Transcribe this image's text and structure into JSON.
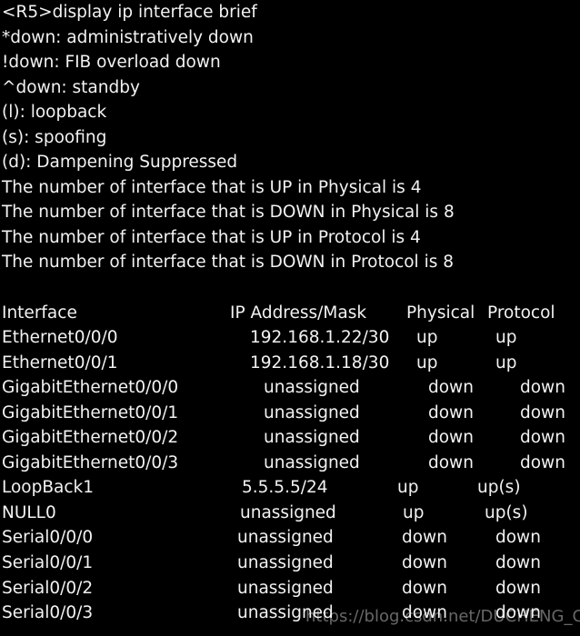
{
  "terminal": {
    "prompt_line": "<R5>display ip interface brief",
    "legend": [
      "*down: administratively down",
      "!down: FIB overload down",
      "^down: standby",
      "(l): loopback",
      "(s): spoofing",
      "(d): Dampening Suppressed"
    ],
    "summary": [
      "The number of interface that is UP in Physical is 4",
      "The number of interface that is DOWN in Physical is 8",
      "The number of interface that is UP in Protocol is 4",
      "The number of interface that is DOWN in Protocol is 8"
    ],
    "summary_counts": {
      "up_physical": 4,
      "down_physical": 8,
      "up_protocol": 4,
      "down_protocol": 8
    },
    "table": {
      "headers": {
        "interface": "Interface",
        "ip_address_mask": "IP Address/Mask",
        "physical": "Physical",
        "protocol": "Protocol"
      },
      "rows": [
        {
          "interface": "Ethernet0/0/0",
          "ip": "192.168.1.22/30",
          "physical": "up",
          "protocol": "up"
        },
        {
          "interface": "Ethernet0/0/1",
          "ip": "192.168.1.18/30",
          "physical": "up",
          "protocol": "up"
        },
        {
          "interface": "GigabitEthernet0/0/0",
          "ip": "unassigned",
          "physical": "down",
          "protocol": "down"
        },
        {
          "interface": "GigabitEthernet0/0/1",
          "ip": "unassigned",
          "physical": "down",
          "protocol": "down"
        },
        {
          "interface": "GigabitEthernet0/0/2",
          "ip": "unassigned",
          "physical": "down",
          "protocol": "down"
        },
        {
          "interface": "GigabitEthernet0/0/3",
          "ip": "unassigned",
          "physical": "down",
          "protocol": "down"
        },
        {
          "interface": "LoopBack1",
          "ip": "5.5.5.5/24",
          "physical": "up",
          "protocol": "up(s)"
        },
        {
          "interface": "NULL0",
          "ip": "unassigned",
          "physical": "up",
          "protocol": "up(s)"
        },
        {
          "interface": "Serial0/0/0",
          "ip": "unassigned",
          "physical": "down",
          "protocol": "down"
        },
        {
          "interface": "Serial0/0/1",
          "ip": "unassigned",
          "physical": "down",
          "protocol": "down"
        },
        {
          "interface": "Serial0/0/2",
          "ip": "unassigned",
          "physical": "down",
          "protocol": "down"
        },
        {
          "interface": "Serial0/0/3",
          "ip": "unassigned",
          "physical": "down",
          "protocol": "down"
        }
      ]
    }
  },
  "watermark": {
    "text": "https://blog.csdn.net/DUCHENG_CHENG"
  },
  "colors": {
    "background": "#000000",
    "text": "#f2f2f2",
    "watermark": "#ffffff"
  }
}
